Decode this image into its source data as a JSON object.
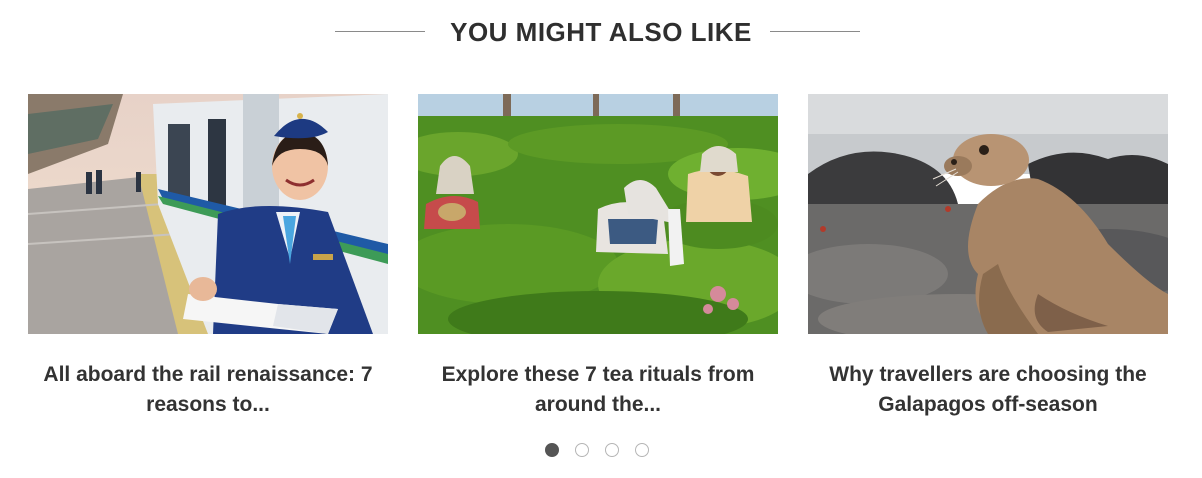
{
  "section": {
    "title": "YOU MIGHT ALSO LIKE"
  },
  "cards": [
    {
      "title": "All aboard the rail renaissance: 7 reasons to...",
      "image": "train-attendant-photo"
    },
    {
      "title": "Explore these 7 tea rituals from around the...",
      "image": "tea-pickers-photo"
    },
    {
      "title": "Why travellers are choosing the Galapagos off-season",
      "image": "sea-lion-photo"
    }
  ],
  "pagination": {
    "total": 4,
    "active": 1
  },
  "colors": {
    "heading": "#2f2f2f",
    "text": "#333333",
    "dot_active": "#555555",
    "dot_inactive_border": "#b5b5b5"
  }
}
